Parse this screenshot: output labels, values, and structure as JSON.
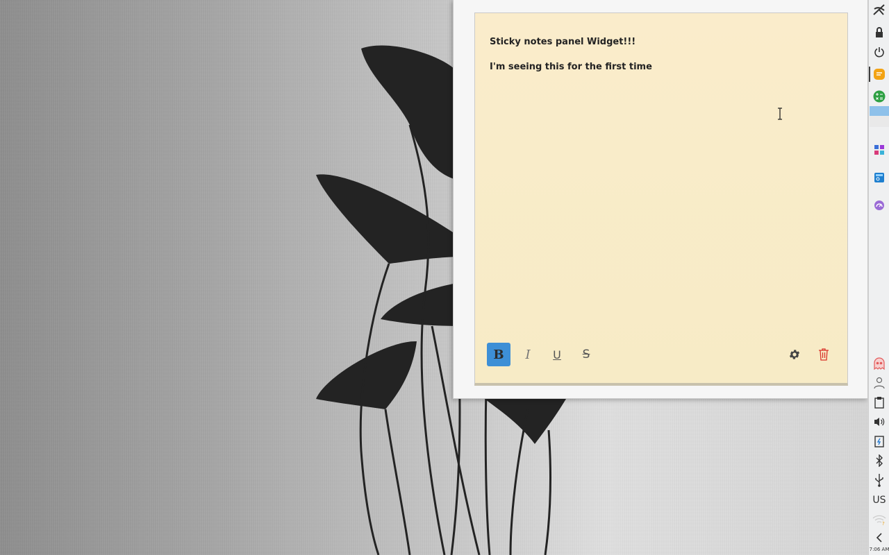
{
  "note": {
    "lines": [
      "Sticky notes panel Widget!!!",
      "I'm seeing this for the first time"
    ],
    "background_color": "#f8ecc8"
  },
  "toolbar": {
    "bold_label": "B",
    "italic_label": "I",
    "underline_label": "U",
    "strikethrough_label": "S",
    "bold_active": true,
    "accent_color": "#3d8fd6",
    "settings_icon": "gear-icon",
    "delete_icon": "trash-icon",
    "delete_color": "#d9342b"
  },
  "panel": {
    "icons": [
      "application-launcher-icon",
      "lock-screen-icon",
      "power-icon",
      "sticky-notes-icon",
      "calculator-icon",
      "window-thumbnail",
      "app-grid-icon",
      "file-manager-icon",
      "system-monitor-icon",
      "ghost-icon",
      "user-switcher-icon",
      "clipboard-icon",
      "volume-icon",
      "battery-icon",
      "bluetooth-icon",
      "usb-icon",
      "network-icon",
      "collapse-arrow-icon"
    ],
    "keyboard_layout": "US",
    "clock": "7:06 AM"
  }
}
